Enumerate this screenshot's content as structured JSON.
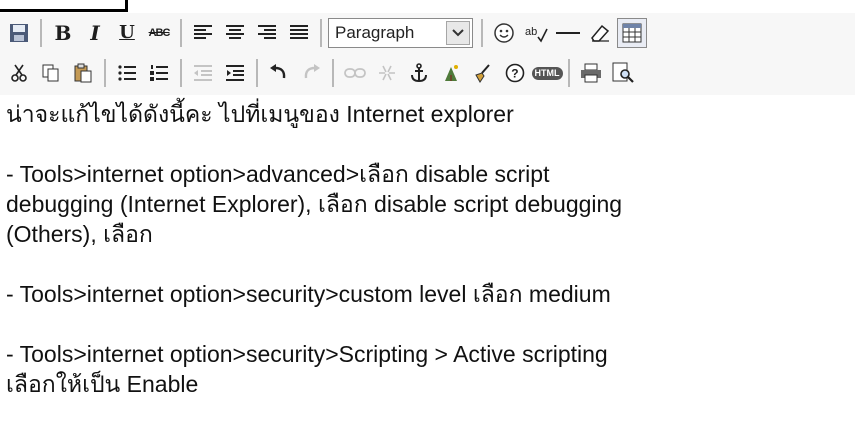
{
  "toolbar": {
    "format_select": {
      "value": "Paragraph"
    },
    "html_label": "HTML"
  },
  "content": {
    "line1": "น่าจะแก้ไขได้ดังนี้คะ ไปที่เมนูของ Internet explorer",
    "item1_line1": "- Tools>internet option>advanced>เลือก disable script",
    "item1_line2": "debugging (Internet Explorer), เลือก disable script debugging",
    "item1_line3": "(Others), เลือก",
    "item2": "- Tools>internet option>security>custom level เลือก medium",
    "item3_line1": "- Tools>internet option>security>Scripting > Active scripting",
    "item3_line2": "เลือกให้เป็น Enable"
  }
}
